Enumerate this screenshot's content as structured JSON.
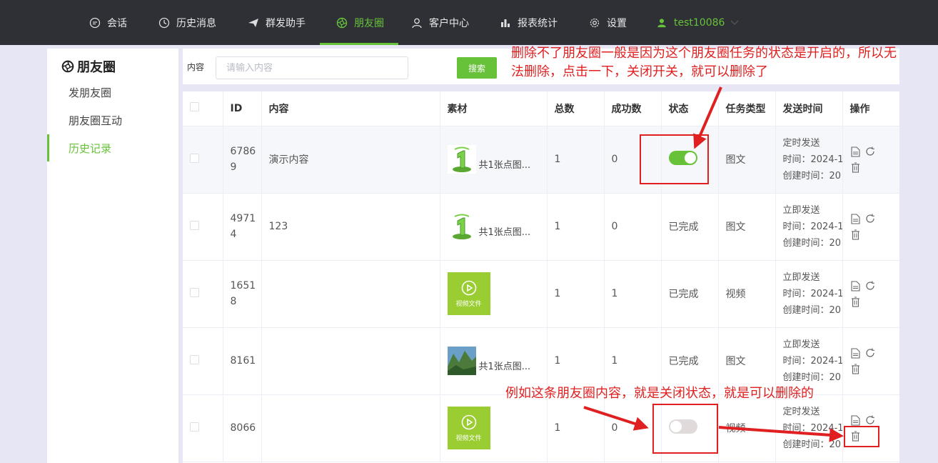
{
  "nav": {
    "items": [
      {
        "label": "会话",
        "icon": "chat-icon"
      },
      {
        "label": "历史消息",
        "icon": "clock-icon"
      },
      {
        "label": "群发助手",
        "icon": "send-icon"
      },
      {
        "label": "朋友圈",
        "icon": "aperture-icon"
      },
      {
        "label": "客户中心",
        "icon": "user-icon"
      },
      {
        "label": "报表统计",
        "icon": "bar-chart-icon"
      },
      {
        "label": "设置",
        "icon": "gear-icon"
      }
    ],
    "active": "朋友圈",
    "user": "test10086",
    "colors": {
      "bg": "#2e3035",
      "accent": "#67c23a"
    }
  },
  "sidebar": {
    "title": "朋友圈",
    "items": [
      {
        "label": "发朋友圈"
      },
      {
        "label": "朋友圈互动"
      },
      {
        "label": "历史记录"
      }
    ],
    "active": "历史记录"
  },
  "search": {
    "label": "内容",
    "placeholder": "请输入内容",
    "button": "搜索"
  },
  "table": {
    "headers": {
      "id": "ID",
      "content": "内容",
      "material": "素材",
      "total": "总数",
      "success": "成功数",
      "status": "状态",
      "task_type": "任务类型",
      "send_time": "发送时间",
      "ops": "操作"
    },
    "rows": [
      {
        "id": "67869",
        "content": "演示内容",
        "material": "共1张点图...",
        "material_kind": "image-green",
        "total": "1",
        "success": "0",
        "status": "on",
        "task_type": "图文",
        "send_mode": "定时发送",
        "time": "时间：2024-1",
        "created": "创建时间：20"
      },
      {
        "id": "49714",
        "content": "123",
        "material": "共1张点图...",
        "material_kind": "image-green",
        "total": "1",
        "success": "0",
        "status": "已完成",
        "task_type": "图文",
        "send_mode": "立即发送",
        "time": "时间：2024-1",
        "created": "创建时间：20"
      },
      {
        "id": "16518",
        "content": "",
        "material": "视频文件",
        "material_kind": "video",
        "total": "1",
        "success": "1",
        "status": "已完成",
        "task_type": "视频",
        "send_mode": "立即发送",
        "time": "时间：2024-1",
        "created": "创建时间：20"
      },
      {
        "id": "8161",
        "content": "",
        "material": "共1张点图...",
        "material_kind": "image-landscape",
        "total": "1",
        "success": "1",
        "status": "已完成",
        "task_type": "图文",
        "send_mode": "立即发送",
        "time": "时间：2024-1",
        "created": "创建时间：20"
      },
      {
        "id": "8066",
        "content": "",
        "material": "视频文件",
        "material_kind": "video",
        "total": "1",
        "success": "0",
        "status": "off",
        "task_type": "视频",
        "send_mode": "定时发送",
        "time": "时间：2024-1",
        "created": "创建时间：20"
      }
    ]
  },
  "annotations": {
    "top": "删除不了朋友圈一般是因为这个朋友圈任务的状态是开启的，所以无法删除，点击一下，关闭开关，就可以删除了",
    "bottom": "例如这条朋友圈内容，就是关闭状态，就是可以删除的"
  }
}
